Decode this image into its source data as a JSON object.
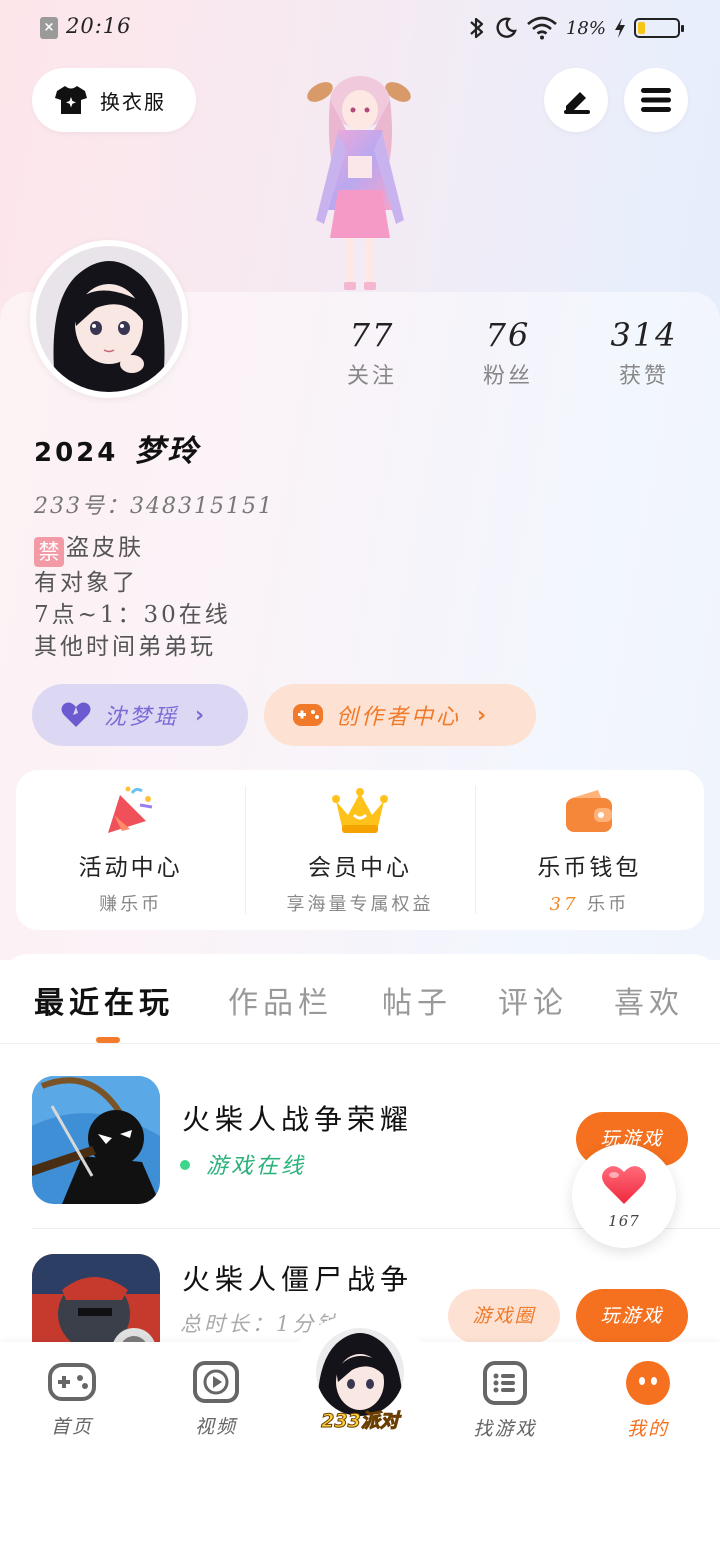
{
  "status_bar": {
    "time": "20:16",
    "battery_text": "18%",
    "battery_level": 0.18
  },
  "header": {
    "outfit_label": "换衣服"
  },
  "profile": {
    "stats": [
      {
        "value": "77",
        "label": "关注"
      },
      {
        "value": "76",
        "label": "粉丝"
      },
      {
        "value": "314",
        "label": "获赞"
      }
    ],
    "year_tag": "2024",
    "nickname": "梦玲",
    "uid": "233号：348315151",
    "bio_badge": "禁",
    "bio_lines": [
      "盗皮肤",
      "有对象了",
      "7点~1：30在线",
      "其他时间弟弟玩"
    ],
    "guild_label": "沈梦瑶",
    "creator_label": "创作者中心"
  },
  "features": [
    {
      "title": "活动中心",
      "subtitle": "赚乐币"
    },
    {
      "title": "会员中心",
      "subtitle": "享海量专属权益"
    },
    {
      "title": "乐币钱包",
      "coin_amount": "37",
      "coin_unit": "乐币"
    }
  ],
  "tabs": [
    "最近在玩",
    "作品栏",
    "帖子",
    "评论",
    "喜欢"
  ],
  "active_tab": 0,
  "recent_games": [
    {
      "name": "火柴人战争荣耀",
      "status": "游戏在线",
      "play_label": "玩游戏"
    },
    {
      "name": "火柴人僵尸战争",
      "playtime": "总时长：1分钟",
      "circle_label": "游戏圈",
      "play_label": "玩游戏"
    }
  ],
  "favorite_float": {
    "count": "167"
  },
  "bottom_nav": [
    {
      "label": "首页"
    },
    {
      "label": "视频"
    },
    {
      "label": "233派对"
    },
    {
      "label": "找游戏"
    },
    {
      "label": "我的"
    }
  ],
  "colors": {
    "accent": "#f5711f",
    "online": "#29b27a",
    "guild": "#7a6bd6"
  }
}
